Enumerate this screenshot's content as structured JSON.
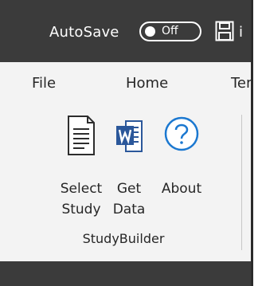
{
  "titlebar": {
    "autosave_label": "AutoSave",
    "autosave_state": "Off",
    "title_fragment": "i"
  },
  "ribbon_tabs": {
    "file": "File",
    "home": "Home",
    "tem": "Tem"
  },
  "group": {
    "label": "StudyBuilder",
    "buttons": {
      "select_study": "Select\nStudy",
      "get_data": "Get\nData",
      "about": "About"
    }
  },
  "colors": {
    "titlebar": "#3b3b3b",
    "ribbon": "#f3f3f3",
    "word_blue": "#2b579a",
    "about_blue": "#1b78d0"
  }
}
